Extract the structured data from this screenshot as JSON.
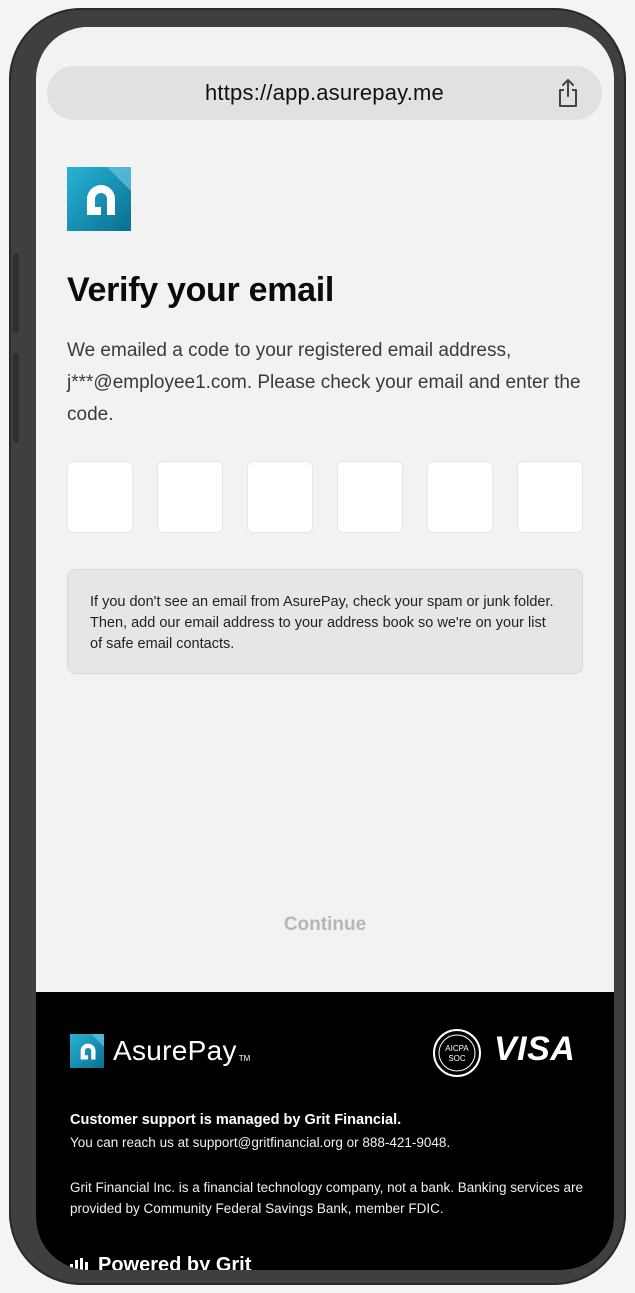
{
  "browser": {
    "url": "https://app.asurepay.me",
    "share_icon": "share-icon"
  },
  "page": {
    "title": "Verify your email",
    "description": "We emailed a code to your registered email address, j***@employee1.com. Please check your email and enter the code.",
    "code_digits": [
      "",
      "",
      "",
      "",
      "",
      ""
    ],
    "notice": "If you don't see an email from AsurePay, check your spam or junk folder. Then, add our email address to your address book so we're on your list of safe email contacts.",
    "continue_label": "Continue"
  },
  "footer": {
    "brand_name": "AsurePay",
    "brand_tm": "TM",
    "soc_badge": "AICPA SOC",
    "visa_label": "VISA",
    "support_title": "Customer support is managed by Grit Financial.",
    "support_text": "You can reach us at support@gritfinancial.org or 888-421-9048.",
    "legal_text": "Grit Financial Inc. is a financial technology company, not a bank. Banking services are provided by Community Federal Savings Bank, member FDIC.",
    "powered_by": "Powered by Grit"
  },
  "colors": {
    "brand_teal": "#1aa3c9",
    "brand_dark": "#0b6e8e",
    "footer_bg": "#000000",
    "continue_disabled": "#b6b6b6"
  }
}
